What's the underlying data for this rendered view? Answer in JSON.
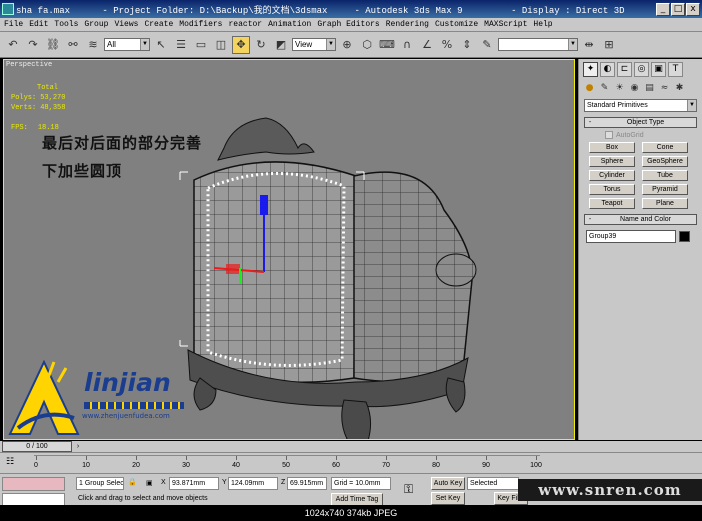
{
  "window": {
    "title": "sha fa.max      - Project Folder: D:\\Backup\\我的文档\\3dsmax     - Autodesk 3ds Max 9         - Display : Direct 3D",
    "buttons": [
      "_",
      "□",
      "x"
    ]
  },
  "menu": [
    "File",
    "Edit",
    "Tools",
    "Group",
    "Views",
    "Create",
    "Modifiers",
    "reactor",
    "Animation",
    "Graph Editors",
    "Rendering",
    "Customize",
    "MAXScript",
    "Help"
  ],
  "toolbar": {
    "selection_filter": "All",
    "reference_coord": "View",
    "named_selection": ""
  },
  "viewport": {
    "label": "Perspective",
    "stats": {
      "total_label": "Total",
      "polys_label": "Polys:",
      "polys": "53,270",
      "verts_label": "Verts:",
      "verts": "48,358",
      "fps_label": "FPS:",
      "fps": "18.18"
    },
    "overlay_text_1": "最后对后面的部分完善",
    "overlay_text_2": "下加些圆顶",
    "logo_text": "linjian",
    "logo_url": "www.zhenjuenfudea.com"
  },
  "command_panel": {
    "tabs": [
      "create-tab",
      "modify-tab",
      "hierarchy-tab",
      "motion-tab",
      "display-tab",
      "utilities-tab"
    ],
    "category_dropdown": "Standard Primitives",
    "object_type_title": "Object Type",
    "autogrid_label": "AutoGrid",
    "objects": [
      "Box",
      "Cone",
      "Sphere",
      "GeoSphere",
      "Cylinder",
      "Tube",
      "Torus",
      "Pyramid",
      "Teapot",
      "Plane"
    ],
    "name_color_title": "Name and Color",
    "object_name": "Group39",
    "object_color": "#000000"
  },
  "timeline": {
    "current_frame": "0 / 100",
    "ticks": [
      "0",
      "10",
      "20",
      "30",
      "40",
      "50",
      "60",
      "70",
      "80",
      "90",
      "100"
    ]
  },
  "status": {
    "selection_info": "1 Group Selec",
    "x_label": "X",
    "x_value": "93.871mm",
    "y_label": "Y",
    "y_value": "124.09mm",
    "z_label": "Z",
    "z_value": "69.915mm",
    "grid": "Grid = 10.0mm",
    "prompt": "Click and drag to select and move objects",
    "add_time_tag": "Add Time Tag",
    "auto_key": "Auto Key",
    "set_key": "Set Key",
    "selected": "Selected",
    "key_filters": "Key Filte"
  },
  "watermark": "www.snren.com",
  "image_footer": "1024x740  374kb  JPEG"
}
